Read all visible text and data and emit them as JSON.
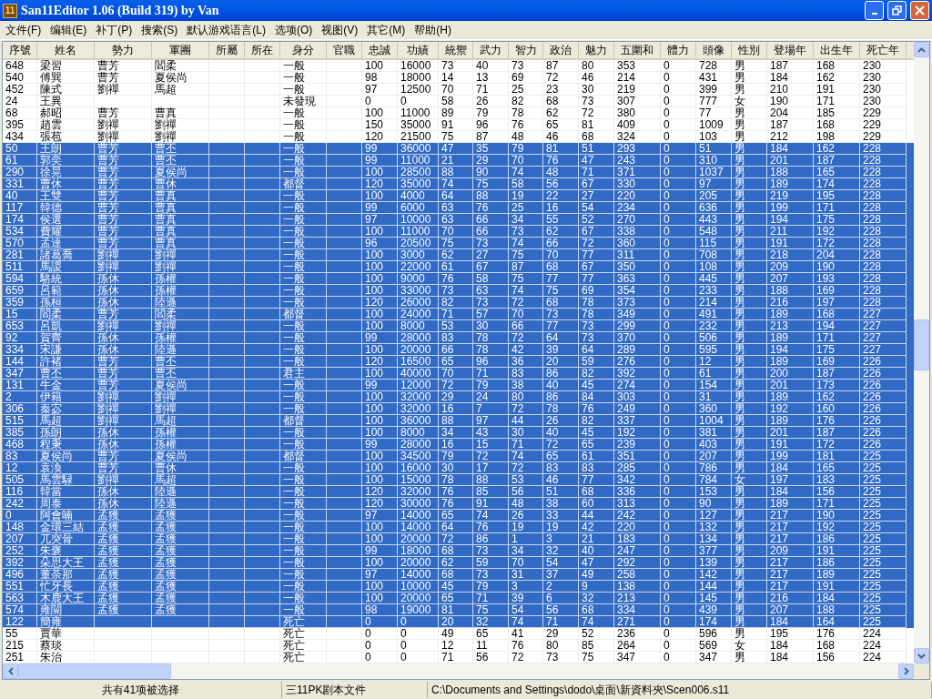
{
  "window": {
    "app_icon_text": "11",
    "title": "San11Editor 1.06 (Build 319) by Van"
  },
  "menu": [
    "文件(F)",
    "编辑(E)",
    "补丁(P)",
    "搜索(S)",
    "默认游戏语言(L)",
    "选项(O)",
    "视图(V)",
    "其它(M)",
    "帮助(H)"
  ],
  "table": {
    "columns": [
      "序號",
      "姓名",
      "勢力",
      "軍團",
      "所屬",
      "所在",
      "身分",
      "官職",
      "忠誠",
      "功績",
      "統禦",
      "武力",
      "智力",
      "政治",
      "魅力",
      "五圍和",
      "體力",
      "頭像",
      "性別",
      "登場年",
      "出生年",
      "死亡年"
    ],
    "rows": [
      {
        "selected": false,
        "cells": [
          "648",
          "梁習",
          "曹芳",
          "閻柔",
          null,
          null,
          "一般",
          null,
          "100",
          "16000",
          "73",
          "40",
          "73",
          "87",
          "80",
          "353",
          "0",
          "728",
          "男",
          "187",
          "168",
          "230"
        ]
      },
      {
        "selected": false,
        "cells": [
          "540",
          "傅巽",
          "曹芳",
          "夏侯尚",
          null,
          null,
          "一般",
          null,
          "98",
          "18000",
          "14",
          "13",
          "69",
          "72",
          "46",
          "214",
          "0",
          "431",
          "男",
          "184",
          "162",
          "230"
        ]
      },
      {
        "selected": false,
        "cells": [
          "452",
          "陳式",
          "劉禪",
          "馬超",
          null,
          null,
          "一般",
          null,
          "97",
          "12500",
          "70",
          "71",
          "25",
          "23",
          "30",
          "219",
          "0",
          "399",
          "男",
          "210",
          "191",
          "230"
        ]
      },
      {
        "selected": false,
        "cells": [
          "24",
          "王異",
          null,
          null,
          null,
          null,
          "未發現",
          null,
          "0",
          "0",
          "58",
          "26",
          "82",
          "68",
          "73",
          "307",
          "0",
          "777",
          "女",
          "190",
          "171",
          "230"
        ]
      },
      {
        "selected": false,
        "cells": [
          "68",
          "郝昭",
          "曹芳",
          "曹真",
          null,
          null,
          "一般",
          null,
          "100",
          "11000",
          "89",
          "79",
          "78",
          "62",
          "72",
          "380",
          "0",
          "77",
          "男",
          "204",
          "185",
          "229"
        ]
      },
      {
        "selected": false,
        "cells": [
          "395",
          "趙雲",
          "劉禪",
          "劉禪",
          null,
          null,
          "一般",
          null,
          "150",
          "35000",
          "91",
          "96",
          "76",
          "65",
          "81",
          "409",
          "0",
          "1009",
          "男",
          "187",
          "168",
          "229"
        ]
      },
      {
        "selected": false,
        "cells": [
          "434",
          "張苞",
          "劉禪",
          "劉禪",
          null,
          null,
          "一般",
          null,
          "120",
          "21500",
          "75",
          "87",
          "48",
          "46",
          "68",
          "324",
          "0",
          "103",
          "男",
          "212",
          "198",
          "229"
        ]
      },
      {
        "selected": true,
        "cells": [
          "50",
          "王朗",
          "曹芳",
          "曹丕",
          null,
          null,
          "一般",
          null,
          "99",
          "36000",
          "47",
          "35",
          "79",
          "81",
          "51",
          "293",
          "0",
          "51",
          "男",
          "184",
          "162",
          "228"
        ]
      },
      {
        "selected": true,
        "cells": [
          "61",
          "郭奕",
          "曹芳",
          "曹丕",
          null,
          null,
          "一般",
          null,
          "99",
          "11000",
          "21",
          "29",
          "70",
          "76",
          "47",
          "243",
          "0",
          "310",
          "男",
          "201",
          "187",
          "228"
        ]
      },
      {
        "selected": true,
        "cells": [
          "290",
          "徐晃",
          "曹芳",
          "夏侯尚",
          null,
          null,
          "一般",
          null,
          "100",
          "28500",
          "88",
          "90",
          "74",
          "48",
          "71",
          "371",
          "0",
          "1037",
          "男",
          "188",
          "165",
          "228"
        ]
      },
      {
        "selected": true,
        "cells": [
          "331",
          "曹休",
          "曹芳",
          "曹休",
          null,
          null,
          "都督",
          null,
          "120",
          "35000",
          "74",
          "75",
          "58",
          "56",
          "67",
          "330",
          "0",
          "97",
          "男",
          "189",
          "174",
          "228"
        ]
      },
      {
        "selected": true,
        "cells": [
          "40",
          "王雙",
          "曹芳",
          "曹真",
          null,
          null,
          "一般",
          null,
          "100",
          "4000",
          "64",
          "88",
          "19",
          "22",
          "27",
          "220",
          "0",
          "205",
          "男",
          "219",
          "195",
          "228"
        ]
      },
      {
        "selected": true,
        "cells": [
          "117",
          "韓德",
          "曹芳",
          "曹真",
          null,
          null,
          "一般",
          null,
          "99",
          "6000",
          "63",
          "76",
          "25",
          "16",
          "54",
          "234",
          "0",
          "636",
          "男",
          "199",
          "171",
          "228"
        ]
      },
      {
        "selected": true,
        "cells": [
          "174",
          "侯選",
          "曹芳",
          "曹真",
          null,
          null,
          "一般",
          null,
          "97",
          "10000",
          "63",
          "66",
          "34",
          "55",
          "52",
          "270",
          "0",
          "443",
          "男",
          "194",
          "175",
          "228"
        ]
      },
      {
        "selected": true,
        "cells": [
          "534",
          "費耀",
          "曹芳",
          "曹真",
          null,
          null,
          "一般",
          null,
          "100",
          "11000",
          "70",
          "66",
          "73",
          "62",
          "67",
          "338",
          "0",
          "548",
          "男",
          "211",
          "192",
          "228"
        ]
      },
      {
        "selected": true,
        "cells": [
          "570",
          "孟達",
          "曹芳",
          "曹真",
          null,
          null,
          "一般",
          null,
          "96",
          "20500",
          "75",
          "73",
          "74",
          "66",
          "72",
          "360",
          "0",
          "115",
          "男",
          "191",
          "172",
          "228"
        ]
      },
      {
        "selected": true,
        "cells": [
          "281",
          "諸葛喬",
          "劉禪",
          "劉禪",
          null,
          null,
          "一般",
          null,
          "100",
          "3000",
          "62",
          "27",
          "75",
          "70",
          "77",
          "311",
          "0",
          "708",
          "男",
          "218",
          "204",
          "228"
        ]
      },
      {
        "selected": true,
        "cells": [
          "511",
          "馬謖",
          "劉禪",
          "劉禪",
          null,
          null,
          "一般",
          null,
          "100",
          "22000",
          "61",
          "67",
          "87",
          "68",
          "67",
          "350",
          "0",
          "108",
          "男",
          "209",
          "190",
          "228"
        ]
      },
      {
        "selected": true,
        "cells": [
          "594",
          "駱統",
          "孫休",
          "孫權",
          null,
          null,
          "一般",
          null,
          "100",
          "9000",
          "76",
          "58",
          "75",
          "77",
          "77",
          "363",
          "0",
          "445",
          "男",
          "207",
          "193",
          "228"
        ]
      },
      {
        "selected": true,
        "cells": [
          "659",
          "呂範",
          "孫休",
          "孫權",
          null,
          null,
          "一般",
          null,
          "100",
          "33000",
          "73",
          "63",
          "74",
          "75",
          "69",
          "354",
          "0",
          "233",
          "男",
          "188",
          "169",
          "228"
        ]
      },
      {
        "selected": true,
        "cells": [
          "359",
          "孫桓",
          "孫休",
          "陸遜",
          null,
          null,
          "一般",
          null,
          "120",
          "26000",
          "82",
          "73",
          "72",
          "68",
          "78",
          "373",
          "0",
          "214",
          "男",
          "216",
          "197",
          "228"
        ]
      },
      {
        "selected": true,
        "cells": [
          "15",
          "閻柔",
          "曹芳",
          "閻柔",
          null,
          null,
          "都督",
          null,
          "100",
          "24000",
          "71",
          "57",
          "70",
          "73",
          "78",
          "349",
          "0",
          "491",
          "男",
          "189",
          "168",
          "227"
        ]
      },
      {
        "selected": true,
        "cells": [
          "653",
          "呂凱",
          "劉禪",
          "劉禪",
          null,
          null,
          "一般",
          null,
          "100",
          "8000",
          "53",
          "30",
          "66",
          "77",
          "73",
          "299",
          "0",
          "232",
          "男",
          "213",
          "194",
          "227"
        ]
      },
      {
        "selected": true,
        "cells": [
          "92",
          "賀齊",
          "孫休",
          "孫權",
          null,
          null,
          "一般",
          null,
          "99",
          "28000",
          "83",
          "78",
          "72",
          "64",
          "73",
          "370",
          "0",
          "506",
          "男",
          "189",
          "171",
          "227"
        ]
      },
      {
        "selected": true,
        "cells": [
          "334",
          "宋謙",
          "孫休",
          "陸遜",
          null,
          null,
          "一般",
          null,
          "100",
          "20000",
          "66",
          "78",
          "42",
          "39",
          "64",
          "289",
          "0",
          "595",
          "男",
          "194",
          "175",
          "227"
        ]
      },
      {
        "selected": true,
        "cells": [
          "144",
          "許褚",
          "曹芳",
          "曹丕",
          null,
          null,
          "一般",
          null,
          "120",
          "16500",
          "65",
          "96",
          "36",
          "20",
          "59",
          "276",
          "0",
          "12",
          "男",
          "189",
          "169",
          "226"
        ]
      },
      {
        "selected": true,
        "cells": [
          "347",
          "曹丕",
          "曹芳",
          "曹丕",
          null,
          null,
          "君主",
          null,
          "100",
          "40000",
          "70",
          "71",
          "83",
          "86",
          "82",
          "392",
          "0",
          "61",
          "男",
          "200",
          "187",
          "226"
        ]
      },
      {
        "selected": true,
        "cells": [
          "131",
          "牛金",
          "曹芳",
          "夏侯尚",
          null,
          null,
          "一般",
          null,
          "99",
          "12000",
          "72",
          "79",
          "38",
          "40",
          "45",
          "274",
          "0",
          "154",
          "男",
          "201",
          "173",
          "226"
        ]
      },
      {
        "selected": true,
        "cells": [
          "2",
          "伊籍",
          "劉禪",
          "劉禪",
          null,
          null,
          "一般",
          null,
          "100",
          "32000",
          "29",
          "24",
          "80",
          "86",
          "84",
          "303",
          "0",
          "31",
          "男",
          "189",
          "162",
          "226"
        ]
      },
      {
        "selected": true,
        "cells": [
          "306",
          "秦宓",
          "劉禪",
          "劉禪",
          null,
          null,
          "一般",
          null,
          "100",
          "32000",
          "16",
          "7",
          "72",
          "78",
          "76",
          "249",
          "0",
          "360",
          "男",
          "192",
          "160",
          "226"
        ]
      },
      {
        "selected": true,
        "cells": [
          "515",
          "馬超",
          "劉禪",
          "馬超",
          null,
          null,
          "都督",
          null,
          "100",
          "36000",
          "88",
          "97",
          "44",
          "26",
          "82",
          "337",
          "0",
          "1004",
          "男",
          "189",
          "176",
          "226"
        ]
      },
      {
        "selected": true,
        "cells": [
          "385",
          "孫朗",
          "孫休",
          "孫權",
          null,
          null,
          "一般",
          null,
          "100",
          "8000",
          "34",
          "43",
          "30",
          "40",
          "45",
          "192",
          "0",
          "381",
          "男",
          "201",
          "187",
          "226"
        ]
      },
      {
        "selected": true,
        "cells": [
          "468",
          "程秉",
          "孫休",
          "孫權",
          null,
          null,
          "一般",
          null,
          "99",
          "28000",
          "16",
          "15",
          "71",
          "72",
          "65",
          "239",
          "0",
          "403",
          "男",
          "191",
          "172",
          "226"
        ]
      },
      {
        "selected": true,
        "cells": [
          "83",
          "夏侯尚",
          "曹芳",
          "夏侯尚",
          null,
          null,
          "都督",
          null,
          "100",
          "34500",
          "79",
          "72",
          "74",
          "65",
          "61",
          "351",
          "0",
          "207",
          "男",
          "199",
          "181",
          "225"
        ]
      },
      {
        "selected": true,
        "cells": [
          "12",
          "袁渙",
          "曹芳",
          "曹休",
          null,
          null,
          "一般",
          null,
          "100",
          "16000",
          "30",
          "17",
          "72",
          "83",
          "83",
          "285",
          "0",
          "786",
          "男",
          "184",
          "165",
          "225"
        ]
      },
      {
        "selected": true,
        "cells": [
          "505",
          "馬雲騄",
          "劉禪",
          "馬超",
          null,
          null,
          "一般",
          null,
          "100",
          "15000",
          "78",
          "88",
          "53",
          "46",
          "77",
          "342",
          "0",
          "784",
          "女",
          "197",
          "183",
          "225"
        ]
      },
      {
        "selected": true,
        "cells": [
          "116",
          "韓當",
          "孫休",
          "陸遜",
          null,
          null,
          "一般",
          null,
          "120",
          "32000",
          "76",
          "85",
          "56",
          "51",
          "68",
          "336",
          "0",
          "153",
          "男",
          "184",
          "156",
          "225"
        ]
      },
      {
        "selected": true,
        "cells": [
          "242",
          "周泰",
          "孫休",
          "陸遜",
          null,
          null,
          "一般",
          null,
          "120",
          "30000",
          "76",
          "91",
          "48",
          "38",
          "60",
          "313",
          "0",
          "90",
          "男",
          "189",
          "171",
          "225"
        ]
      },
      {
        "selected": true,
        "cells": [
          "0",
          "阿會喃",
          "孟獲",
          "孟獲",
          null,
          null,
          "一般",
          null,
          "97",
          "14000",
          "65",
          "74",
          "26",
          "33",
          "44",
          "242",
          "0",
          "127",
          "男",
          "217",
          "190",
          "225"
        ]
      },
      {
        "selected": true,
        "cells": [
          "148",
          "金環三結",
          "孟獲",
          "孟獲",
          null,
          null,
          "一般",
          null,
          "100",
          "14000",
          "64",
          "76",
          "19",
          "19",
          "42",
          "220",
          "0",
          "132",
          "男",
          "217",
          "192",
          "225"
        ]
      },
      {
        "selected": true,
        "cells": [
          "207",
          "兀突骨",
          "孟獲",
          "孟獲",
          null,
          null,
          "一般",
          null,
          "100",
          "20000",
          "72",
          "86",
          "1",
          "3",
          "21",
          "183",
          "0",
          "134",
          "男",
          "217",
          "186",
          "225"
        ]
      },
      {
        "selected": true,
        "cells": [
          "252",
          "朱褒",
          "孟獲",
          "孟獲",
          null,
          null,
          "一般",
          null,
          "99",
          "18000",
          "68",
          "73",
          "34",
          "32",
          "40",
          "247",
          "0",
          "377",
          "男",
          "209",
          "191",
          "225"
        ]
      },
      {
        "selected": true,
        "cells": [
          "392",
          "朵思大王",
          "孟獲",
          "孟獲",
          null,
          null,
          "一般",
          null,
          "100",
          "20000",
          "62",
          "59",
          "70",
          "54",
          "47",
          "292",
          "0",
          "139",
          "男",
          "217",
          "186",
          "225"
        ]
      },
      {
        "selected": true,
        "cells": [
          "496",
          "董荼那",
          "孟獲",
          "孟獲",
          null,
          null,
          "一般",
          null,
          "97",
          "14000",
          "68",
          "73",
          "31",
          "37",
          "49",
          "258",
          "0",
          "142",
          "男",
          "217",
          "189",
          "225"
        ]
      },
      {
        "selected": true,
        "cells": [
          "551",
          "忙牙長",
          "孟獲",
          "孟獲",
          null,
          null,
          "一般",
          null,
          "100",
          "10000",
          "45",
          "79",
          "3",
          "2",
          "9",
          "138",
          "0",
          "144",
          "男",
          "217",
          "191",
          "225"
        ]
      },
      {
        "selected": true,
        "cells": [
          "563",
          "木鹿大王",
          "孟獲",
          "孟獲",
          null,
          null,
          "一般",
          null,
          "100",
          "20000",
          "65",
          "71",
          "39",
          "6",
          "32",
          "213",
          "0",
          "145",
          "男",
          "216",
          "184",
          "225"
        ]
      },
      {
        "selected": true,
        "cells": [
          "574",
          "雍闓",
          "孟獲",
          "孟獲",
          null,
          null,
          "一般",
          null,
          "98",
          "19000",
          "81",
          "75",
          "54",
          "56",
          "68",
          "334",
          "0",
          "439",
          "男",
          "207",
          "188",
          "225"
        ]
      },
      {
        "selected": true,
        "cells": [
          "122",
          "簡雍",
          null,
          null,
          null,
          null,
          "死亡",
          null,
          "0",
          "0",
          "20",
          "32",
          "74",
          "71",
          "74",
          "271",
          "0",
          "174",
          "男",
          "184",
          "164",
          "225"
        ]
      },
      {
        "selected": false,
        "cells": [
          "55",
          "賈華",
          null,
          null,
          null,
          null,
          "死亡",
          null,
          "0",
          "0",
          "49",
          "65",
          "41",
          "29",
          "52",
          "236",
          "0",
          "596",
          "男",
          "195",
          "176",
          "224"
        ]
      },
      {
        "selected": false,
        "cells": [
          "215",
          "蔡琰",
          null,
          null,
          null,
          null,
          "死亡",
          null,
          "0",
          "0",
          "12",
          "11",
          "76",
          "80",
          "85",
          "264",
          "0",
          "569",
          "女",
          "184",
          "168",
          "224"
        ]
      },
      {
        "selected": false,
        "cells": [
          "251",
          "朱治",
          null,
          null,
          null,
          null,
          "死亡",
          null,
          "0",
          "0",
          "71",
          "56",
          "72",
          "73",
          "75",
          "347",
          "0",
          "347",
          "男",
          "184",
          "156",
          "224"
        ]
      }
    ]
  },
  "status_bar": [
    "共有41项被选择",
    "三11PK剧本文件",
    "C:\\Documents and Settings\\dodo\\桌面\\新資料夾\\Scen006.s11"
  ]
}
